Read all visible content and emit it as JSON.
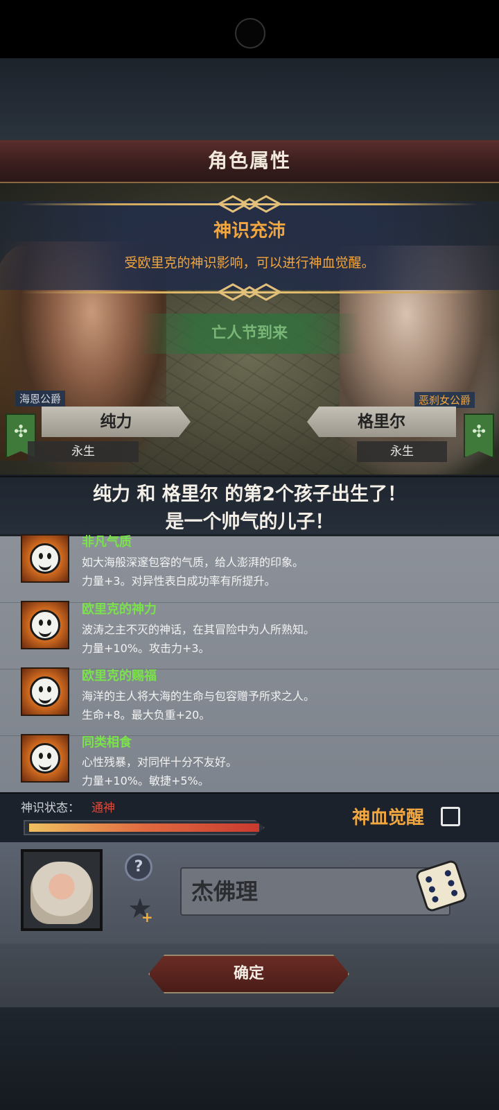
{
  "header": {
    "title": "角色属性"
  },
  "banner": {
    "title": "神识充沛",
    "description": "受欧里克的神识影响，可以进行神血觉醒。"
  },
  "event": {
    "label": "亡人节到来"
  },
  "parents": {
    "left": {
      "title": "海恩公爵",
      "name": "纯力",
      "status": "永生"
    },
    "right": {
      "title": "恶刹女公爵",
      "name": "格里尔",
      "status": "永生"
    }
  },
  "announcement": {
    "line1": "纯力 和 格里尔 的第2个孩子出生了！",
    "line2": "是一个帅气的儿子！"
  },
  "traits": [
    {
      "name": "非凡气质",
      "description": "如大海般深邃包容的气质，给人澎湃的印象。",
      "effect": "力量+3。对异性表白成功率有所提升。"
    },
    {
      "name": "欧里克的神力",
      "description": "波涛之主不灭的神话，在其冒险中为人所熟知。",
      "effect": "力量+10%。攻击力+3。"
    },
    {
      "name": "欧里克的赐福",
      "description": "海洋的主人将大海的生命与包容赠予所求之人。",
      "effect": "生命+8。最大负重+20。"
    },
    {
      "name": "同类相食",
      "description": "心性残暴，对同伴十分不友好。",
      "effect": "力量+10%。敏捷+5%。"
    }
  ],
  "divine_sense": {
    "label": "神识状态：",
    "value": "通神",
    "level": 1.0
  },
  "blood_awaken": {
    "label": "神血觉醒",
    "checked": false
  },
  "child": {
    "name": "杰佛理"
  },
  "confirm_label": "确定",
  "icons": {
    "help": "question-icon",
    "star": "star-plus-icon",
    "dice": "dice-icon",
    "trait": "smiley-face-icon"
  },
  "colors": {
    "accent": "#f2a640",
    "trait_name": "#7ae24a",
    "sense_value": "#e04a3a"
  }
}
